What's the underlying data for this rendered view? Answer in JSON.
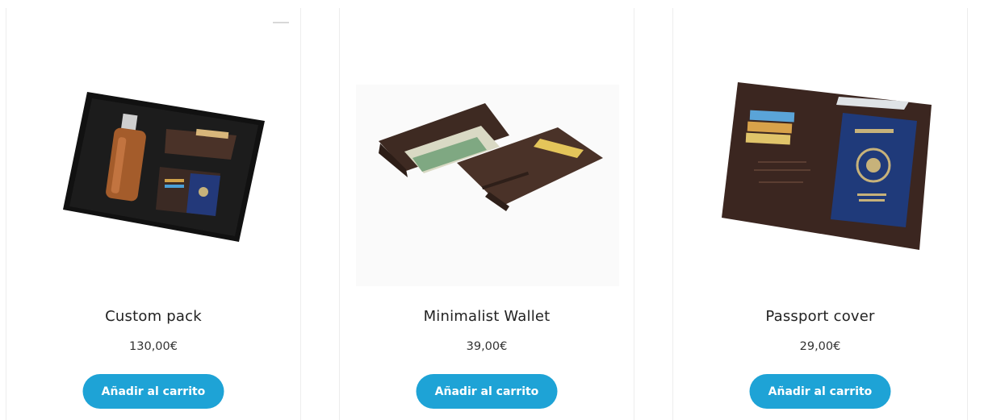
{
  "products": [
    {
      "name": "Custom pack",
      "price": "130,00€",
      "button_label": "Añadir al carrito",
      "image_icon": "gift-box-image"
    },
    {
      "name": "Minimalist Wallet",
      "price": "39,00€",
      "button_label": "Añadir al carrito",
      "image_icon": "wallet-image"
    },
    {
      "name": "Passport cover",
      "price": "29,00€",
      "button_label": "Añadir al carrito",
      "image_icon": "passport-cover-image"
    }
  ],
  "colors": {
    "button": "#1ea3d6",
    "leather": "#4a3228",
    "passport": "#1f3a7a"
  }
}
